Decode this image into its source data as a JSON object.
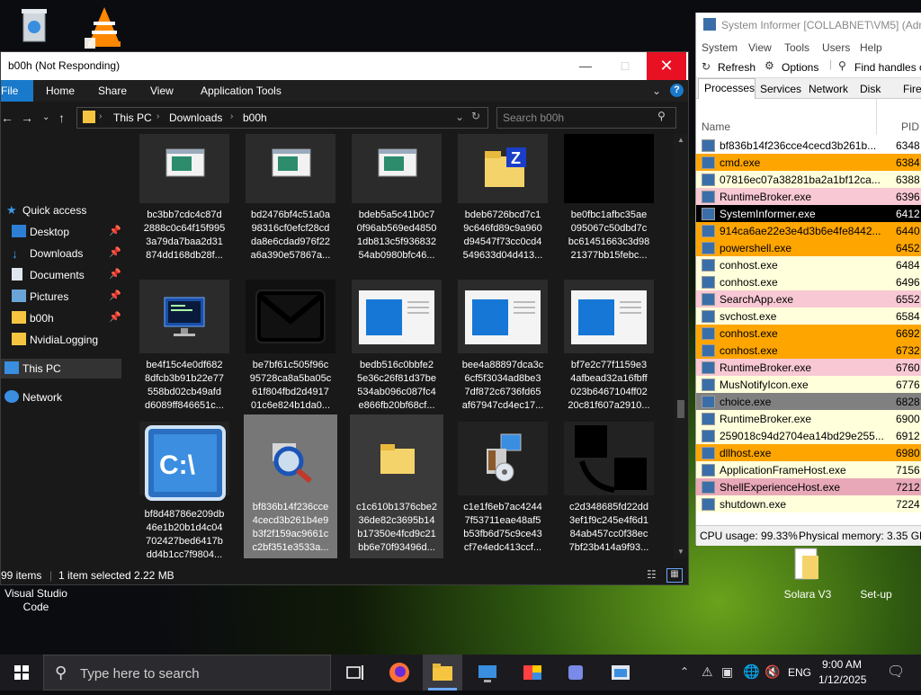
{
  "desktop": {
    "vs_label": "Visual Studio\nCode",
    "solara_label": "Solara V3",
    "setup_label": "Set-up"
  },
  "explorer": {
    "title": "b00h (Not Responding)",
    "ribbon_tabs": [
      "File",
      "Home",
      "Share",
      "View",
      "Application Tools"
    ],
    "breadcrumb": [
      "This PC",
      "Downloads",
      "b00h"
    ],
    "search_placeholder": "Search b00h",
    "nav": [
      {
        "label": "Quick access",
        "pinned": false
      },
      {
        "label": "Desktop",
        "pinned": true
      },
      {
        "label": "Downloads",
        "pinned": true
      },
      {
        "label": "Documents",
        "pinned": true
      },
      {
        "label": "Pictures",
        "pinned": true
      },
      {
        "label": "b00h",
        "pinned": true
      },
      {
        "label": "NvidiaLogging",
        "pinned": false
      },
      {
        "label": "This PC",
        "pinned": false
      },
      {
        "label": "Network",
        "pinned": false
      }
    ],
    "files": [
      {
        "name": "bc3bb7cdc4c87d\n2888c0c64f15f995\n3a79da7baa2d31\n874dd168db28f...",
        "kind": "exe"
      },
      {
        "name": "bd2476bf4c51a0a\n98316cf0efcf28cd\nda8e6cdad976f22\na6a390e57867a...",
        "kind": "exe"
      },
      {
        "name": "bdeb5a5c41b0c7\n0f96ab569ed4850\n1db813c5f936832\n54ab0980bfc46...",
        "kind": "exe"
      },
      {
        "name": "bdeb6726bcd7c1\n9c646fd89c9a960\nd94547f73cc0cd4\n549633d04d413...",
        "kind": "zip"
      },
      {
        "name": "be0fbc1afbc35ae\n095067c50dbd7c\nbc61451663c3d98\n21377bb15febc...",
        "kind": "black"
      },
      {
        "name": "be4f15c4e0df682\n8dfcb3b91b22e77\n558bd02cb49afd\nd6089ff846651c...",
        "kind": "monitor"
      },
      {
        "name": "be7bf61c505f96c\n95728ca8a5ba05c\n61f804fbd2d4917\n01c6e824b1da0...",
        "kind": "mail"
      },
      {
        "name": "bedb516c0bbfe2\n5e36c26f81d37be\n534ab096c087fc4\ne866fb20bf68cf...",
        "kind": "window"
      },
      {
        "name": "bee4a88897dca3c\n6cf5f3034ad8be3\n7df872c6736fd65\naf67947cd4ec17...",
        "kind": "window"
      },
      {
        "name": "bf7e2c77f1159e3\n4afbead32a16fbff\n023b6467104ff02\n20c81f607a2910...",
        "kind": "window"
      },
      {
        "name": "bf8d48786e209db\n46e1b20b1d4c04\n702427bed6417b\ndd4b1cc7f9804...",
        "kind": "cmd"
      },
      {
        "name": "bf836b14f236cce\n4cecd3b261b4e9\nb3f2f159ac9661c\nc2bf351e3533a...",
        "kind": "search"
      },
      {
        "name": "c1c610b1376cbe2\n36de82c3695b14\nb17350e4fcd9c21\nbb6e70f93496d...",
        "kind": "folder"
      },
      {
        "name": "c1e1f6eb7ac4244\n7f53711eae48af5\nb53fb6d75c9ce43\ncf7e4edc413ccf...",
        "kind": "installer"
      },
      {
        "name": "c2d348685fd22dd\n3ef1f9c245e4f6d1\n84ab457cc0f38ec\n7bf23b414a9f93...",
        "kind": "blackshape"
      }
    ],
    "status": {
      "items": "99 items",
      "selected": "1 item selected",
      "size": "2.22 MB"
    }
  },
  "sysinformer": {
    "title": "System Informer [COLLABNET\\VM5] (Adm",
    "menu": [
      "System",
      "View",
      "Tools",
      "Users",
      "Help"
    ],
    "toolbar": {
      "refresh": "Refresh",
      "options": "Options",
      "find": "Find handles o"
    },
    "tabs": [
      "Processes",
      "Services",
      "Network",
      "Disk",
      "Firew"
    ],
    "col_name": "Name",
    "col_pid": "PID",
    "processes": [
      {
        "name": "bf836b14f236cce4cecd3b261b...",
        "pid": "6348",
        "bg": "#ffffff",
        "fg": "#000000"
      },
      {
        "name": "cmd.exe",
        "pid": "6384",
        "bg": "#ffa500",
        "fg": "#000000"
      },
      {
        "name": "07816ec07a38281ba2a1bf12ca...",
        "pid": "6388",
        "bg": "#ffffdc",
        "fg": "#000000"
      },
      {
        "name": "RuntimeBroker.exe",
        "pid": "6396",
        "bg": "#f8c8d4",
        "fg": "#000000"
      },
      {
        "name": "SystemInformer.exe",
        "pid": "6412",
        "bg": "#000000",
        "fg": "#ffffff"
      },
      {
        "name": "914ca6ae22e3e4d3b6e4fe8442...",
        "pid": "6440",
        "bg": "#ffa500",
        "fg": "#000000"
      },
      {
        "name": "powershell.exe",
        "pid": "6452",
        "bg": "#ffa500",
        "fg": "#000000"
      },
      {
        "name": "conhost.exe",
        "pid": "6484",
        "bg": "#ffffdc",
        "fg": "#000000"
      },
      {
        "name": "conhost.exe",
        "pid": "6496",
        "bg": "#ffffdc",
        "fg": "#000000"
      },
      {
        "name": "SearchApp.exe",
        "pid": "6552",
        "bg": "#f8c8d4",
        "fg": "#000000"
      },
      {
        "name": "svchost.exe",
        "pid": "6584",
        "bg": "#ffffdc",
        "fg": "#000000"
      },
      {
        "name": "conhost.exe",
        "pid": "6692",
        "bg": "#ffa500",
        "fg": "#000000"
      },
      {
        "name": "conhost.exe",
        "pid": "6732",
        "bg": "#ffa500",
        "fg": "#000000"
      },
      {
        "name": "RuntimeBroker.exe",
        "pid": "6760",
        "bg": "#f8c8d4",
        "fg": "#000000"
      },
      {
        "name": "MusNotifyIcon.exe",
        "pid": "6776",
        "bg": "#ffffdc",
        "fg": "#000000"
      },
      {
        "name": "choice.exe",
        "pid": "6828",
        "bg": "#808080",
        "fg": "#000000"
      },
      {
        "name": "RuntimeBroker.exe",
        "pid": "6900",
        "bg": "#ffffdc",
        "fg": "#000000"
      },
      {
        "name": "259018c94d2704ea14bd29e255...",
        "pid": "6912",
        "bg": "#ffffdc",
        "fg": "#000000"
      },
      {
        "name": "dllhost.exe",
        "pid": "6980",
        "bg": "#ffa500",
        "fg": "#000000"
      },
      {
        "name": "ApplicationFrameHost.exe",
        "pid": "7156",
        "bg": "#ffffdc",
        "fg": "#000000"
      },
      {
        "name": "ShellExperienceHost.exe",
        "pid": "7212",
        "bg": "#e8a8b8",
        "fg": "#000000"
      },
      {
        "name": "shutdown.exe",
        "pid": "7224",
        "bg": "#ffffdc",
        "fg": "#000000"
      }
    ],
    "status": {
      "cpu": "CPU usage: 99.33%",
      "mem": "Physical memory: 3.35 GB"
    }
  },
  "taskbar": {
    "search_placeholder": "Type here to search",
    "lang": "ENG",
    "time": "9:00 AM",
    "date": "1/12/2025"
  }
}
